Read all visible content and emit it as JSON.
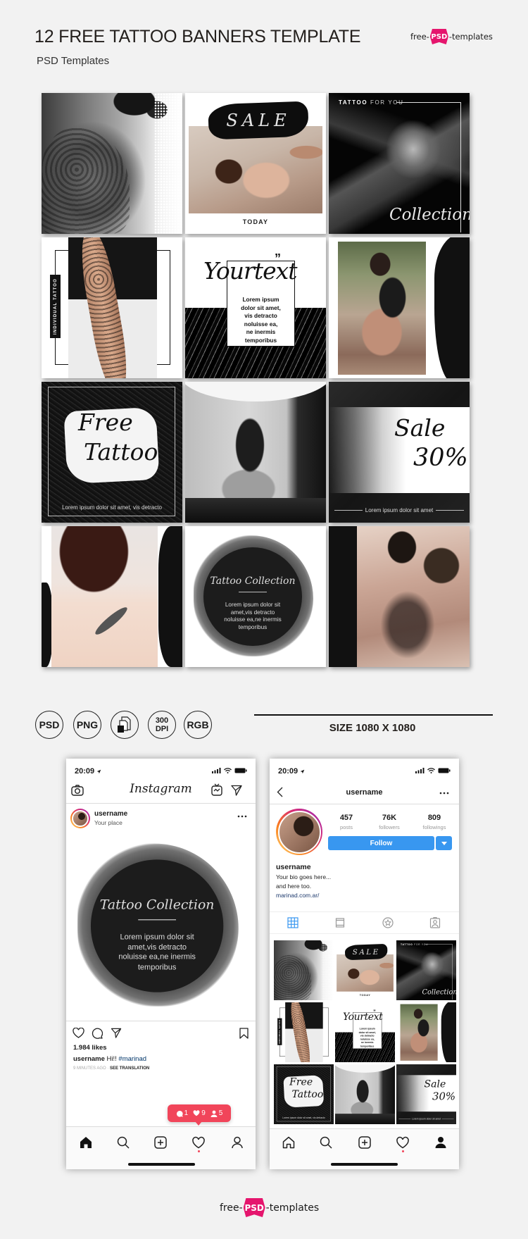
{
  "header": {
    "title": "12 FREE TATTOO BANNERS TEMPLATE",
    "subtitle": "PSD Templates"
  },
  "brand_logo": {
    "prefix": "free-",
    "badge": "PSD",
    "suffix": "-templates"
  },
  "banners": [
    {
      "image": "tattooed-back-photo"
    },
    {
      "headline": "SALE",
      "footer": "TODAY",
      "image": "tattoo-artist-photo"
    },
    {
      "tag_bold": "TATTOO",
      "tag_light": " FOR YOU",
      "script": "Collection",
      "image": "tattooed-man-photo"
    },
    {
      "vertical_label": "INDIVIDUAL TATTOO",
      "image": "tattooed-arm-photo"
    },
    {
      "script": "Yourtext",
      "quote": "”",
      "body_lines": [
        "Lorem ipsum",
        "dolor sit amet,",
        "vis detracto",
        "noluisse ea,",
        "ne inermis",
        "temporibus"
      ]
    },
    {
      "image": "tattooed-woman-sitting-photo"
    },
    {
      "script_line1": "Free",
      "script_line2": "Tattoo",
      "caption": "Lorem ipsum dolor sit amet, vis detracto"
    },
    {
      "image": "woman-arms-tattoo-photo"
    },
    {
      "script_line1": "Sale",
      "script_line2": "30%",
      "caption": "Lorem ipsum dolor sit amet"
    },
    {
      "image": "shoulder-bird-tattoo-photo"
    },
    {
      "script": "Tattoo Collection",
      "body_lines": [
        "Lorem ipsum dolor sit",
        "amet,vis detracto",
        "noluisse ea,ne inermis",
        "temporibus"
      ]
    },
    {
      "image": "tattooed-man-back-photo"
    }
  ],
  "formats": [
    {
      "label": "PSD"
    },
    {
      "label": "PNG"
    },
    {
      "icon": "layers-icon"
    },
    {
      "line1": "300",
      "line2": "DPI"
    },
    {
      "label": "RGB"
    }
  ],
  "size_label": "SIZE 1080 X 1080",
  "feed_phone": {
    "status_time": "20:09",
    "app_title": "Instagram",
    "post": {
      "username": "username",
      "location": "Your place",
      "likes": "1.984 likes",
      "caption_user": "username",
      "caption_text": " Hi!! ",
      "hashtag": "#marinad",
      "time_ago": "9 MINUTES AGO · ",
      "translate": "SEE TRANSLATION"
    },
    "notification": {
      "comments": "1",
      "likes": "9",
      "follows": "5"
    }
  },
  "profile_phone": {
    "status_time": "20:09",
    "username": "username",
    "stats": [
      {
        "value": "457",
        "label": "posts"
      },
      {
        "value": "76K",
        "label": "followers"
      },
      {
        "value": "809",
        "label": "followings"
      }
    ],
    "follow_label": "Follow",
    "display_name": "username",
    "bio": [
      "Your bio goes here...",
      "and here too."
    ],
    "link": "marinad.com.ar/"
  },
  "colors": {
    "background": "#f2f2f2",
    "brand_pink": "#e5156d",
    "notification_red": "#f1455a",
    "follow_blue": "#3897f0",
    "link_blue": "#1f3b6e"
  }
}
